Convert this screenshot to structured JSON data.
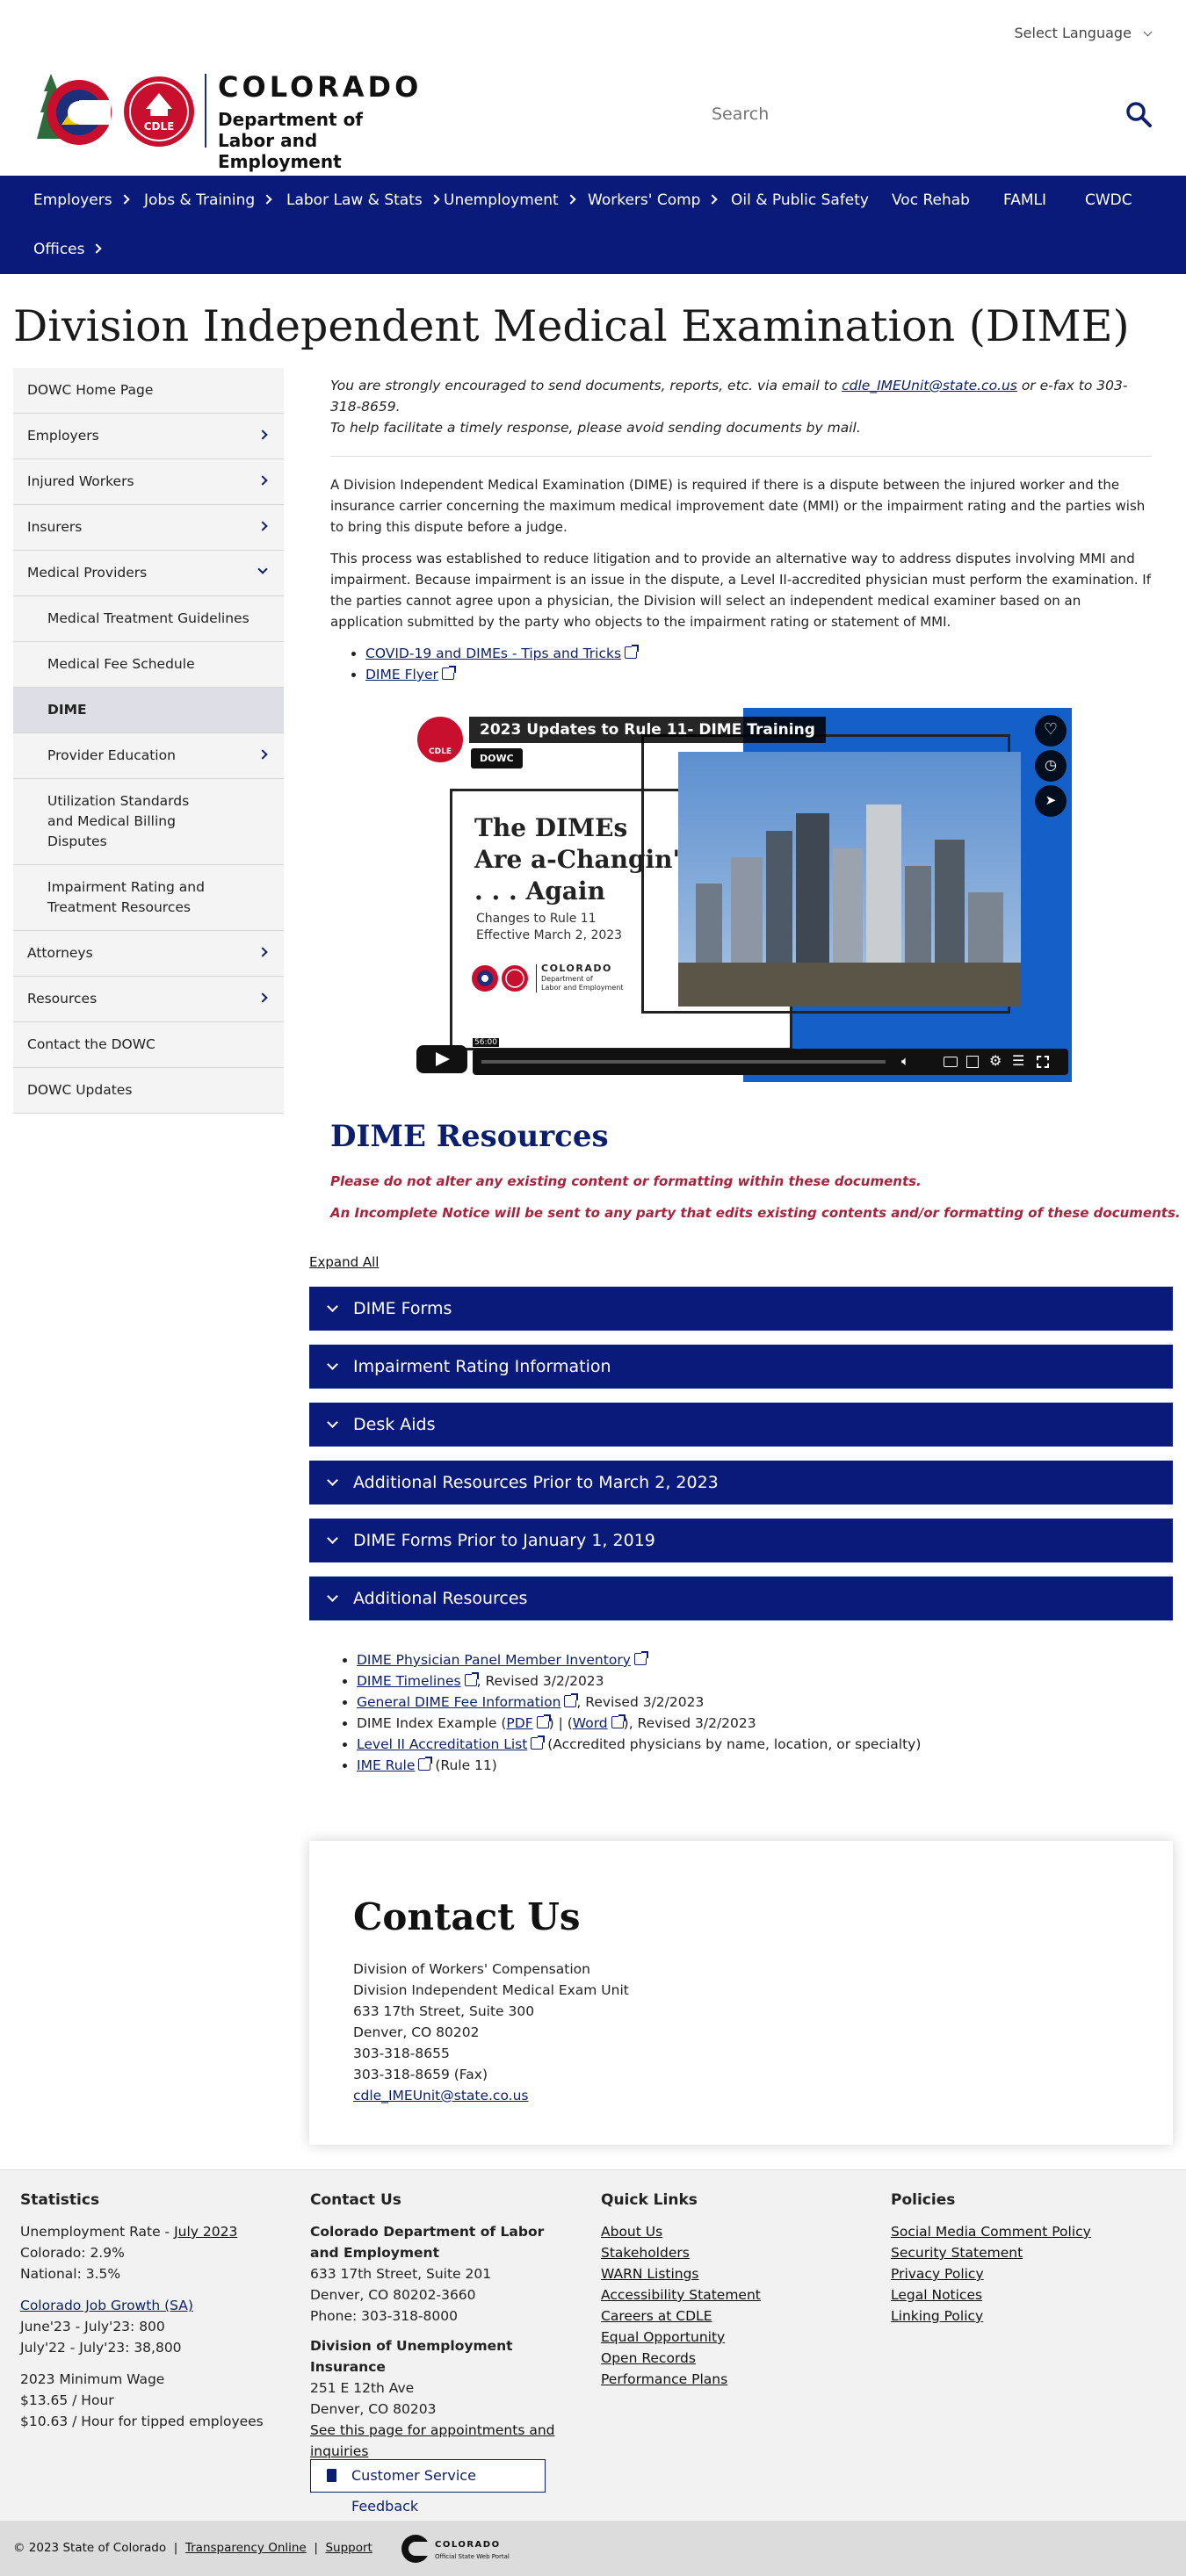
{
  "header": {
    "language_label": "Select Language",
    "logo_title": "COLORADO",
    "logo_sub1": "Department of",
    "logo_sub2": "Labor and Employment",
    "logo_badge": "CDLE",
    "search_placeholder": "Search"
  },
  "nav": {
    "items": [
      {
        "label": "Employers",
        "chev": true
      },
      {
        "label": "Jobs & Training",
        "chev": true
      },
      {
        "label": "Labor Law & Stats",
        "chev": true
      },
      {
        "label": "Unemployment",
        "chev": true
      },
      {
        "label": "Workers' Comp",
        "chev": true
      },
      {
        "label": "Oil & Public Safety",
        "chev": false
      },
      {
        "label": "Voc Rehab",
        "chev": false
      },
      {
        "label": "FAMLI",
        "chev": false
      },
      {
        "label": "CWDC",
        "chev": false
      },
      {
        "label": "Offices",
        "chev": true
      }
    ]
  },
  "page_title": "Division Independent Medical Examination (DIME)",
  "sidebar": {
    "items": [
      {
        "label": "DOWC Home Page"
      },
      {
        "label": "Employers"
      },
      {
        "label": "Injured Workers"
      },
      {
        "label": "Insurers"
      },
      {
        "label": "Medical Providers"
      },
      {
        "label": "Medical Treatment Guidelines"
      },
      {
        "label": "Medical Fee Schedule"
      },
      {
        "label": "DIME"
      },
      {
        "label": "Provider Education"
      },
      {
        "label": "Utilization Standards and Medical Billing Disputes"
      },
      {
        "label": "Impairment Rating and Treatment Resources"
      },
      {
        "label": "Attorneys"
      },
      {
        "label": "Resources"
      },
      {
        "label": "Contact the DOWC"
      },
      {
        "label": "DOWC Updates"
      }
    ]
  },
  "main": {
    "notice_pre": "You are strongly encouraged to send documents, reports, etc. via email to ",
    "notice_email": "cdle_IMEUnit@state.co.us",
    "notice_post": " or e-fax to 303-318-8659.",
    "notice_line2": "To help facilitate a timely response, please avoid sending documents by mail.",
    "para1": "A Division Independent Medical Examination (DIME) is required if there is a dispute between the injured worker and the insurance carrier concerning the maximum medical improvement date (MMI) or the impairment rating and the parties wish to bring this dispute before a judge.",
    "para2": "This process was established to reduce litigation and to provide an alternative way to address disputes involving MMI and impairment. Because impairment is an issue in the dispute, a Level II-accredited physician must perform the examination. If the parties cannot agree upon a physician, the Division will select an independent medical examiner based on an application submitted by the party who objects to the impairment rating or statement of MMI.",
    "link1": "COVID-19 and DIMEs - Tips and Tricks",
    "link2": "DIME Flyer"
  },
  "video": {
    "title": "2023 Updates to Rule 11- DIME Training",
    "channel": "DOWC",
    "badge": "CDLE",
    "slide_line1": "The DIMEs",
    "slide_line2": "Are a-Changin'",
    "slide_line3": ". . . Again",
    "slide_sub1": "Changes to Rule 11",
    "slide_sub2": "Effective March 2, 2023",
    "slide_logo_title": "COLORADO",
    "slide_logo_sub1": "Department of",
    "slide_logo_sub2": "Labor and Employment",
    "time": "56:00"
  },
  "resources": {
    "title": "DIME Resources",
    "warning1": "Please do not alter any existing content or formatting within these documents.",
    "warning2": "An Incomplete Notice will be sent to any party that edits existing contents and/or formatting of these documents.",
    "expand_all": "Expand All",
    "accordions": [
      "DIME Forms",
      "Impairment Rating Information",
      "Desk Aids",
      "Additional Resources Prior to March 2, 2023",
      "DIME Forms Prior to January 1, 2019",
      "Additional Resources"
    ],
    "list": {
      "item1": "DIME Physician Panel Member Inventory",
      "item2": "DIME Timelines",
      "item2_suffix": ", Revised 3/2/2023",
      "item3": "General DIME Fee Information",
      "item3_suffix": ", Revised 3/2/2023",
      "item4_prefix": "DIME Index Example (",
      "item4_pdf": "PDF",
      "item4_mid": ") | (",
      "item4_word": "Word",
      "item4_suffix": "), Revised 3/2/2023",
      "item5": "Level II Accreditation List",
      "item5_suffix": " (Accredited physicians by name, location, or specialty)",
      "item6": "IME Rule",
      "item6_suffix": " (Rule 11)"
    }
  },
  "contact": {
    "title": "Contact Us",
    "line1": "Division of Workers' Compensation",
    "line2": "Division Independent Medical Exam Unit",
    "line3": "633 17th Street, Suite 300",
    "line4": "Denver, CO 80202",
    "line5": "303-318-8655",
    "line6": "303-318-8659 (Fax)",
    "email": "cdle_IMEUnit@state.co.us"
  },
  "footer": {
    "stats": {
      "title": "Statistics",
      "ue_label": "Unemployment Rate - ",
      "ue_link": "July 2023",
      "colorado": "Colorado: 2.9%",
      "national": "National: 3.5%",
      "jobs_link": "Colorado Job Growth (SA)",
      "jobs1": "June'23 - July'23: 800",
      "jobs2": "July'22 - July'23: 38,800",
      "wage_title": "2023 Minimum Wage",
      "wage1": "$13.65 / Hour",
      "wage2": "$10.63 / Hour for tipped employees"
    },
    "contact": {
      "title": "Contact Us",
      "org": "Colorado Department of Labor and Employment",
      "addr1": "633 17th Street, Suite 201",
      "addr2": "Denver, CO  80202-3660",
      "phone": "Phone: 303-318-8000",
      "ui_title": "Division of Unemployment Insurance",
      "ui_addr1": "251 E 12th Ave",
      "ui_addr2": "Denver, CO  80203",
      "ui_link": "See this page for appointments and inquiries",
      "feedback": "Customer Service Feedback"
    },
    "quick_links": {
      "title": "Quick Links",
      "items": [
        "About Us",
        "Stakeholders",
        "WARN Listings",
        "Accessibility Statement",
        "Careers at CDLE",
        "Equal Opportunity",
        "Open Records",
        "Performance Plans"
      ]
    },
    "policies": {
      "title": "Policies",
      "items": [
        "Social Media Comment Policy",
        "Security Statement",
        "Privacy Policy",
        "Legal Notices",
        "Linking Policy"
      ]
    },
    "bottom": {
      "copyright": "© 2023 State of Colorado",
      "transparency": "Transparency Online",
      "support": "Support",
      "state_logo_title": "COLORADO",
      "state_logo_sub": "Official State Web Portal"
    }
  },
  "colors": {
    "navy": "#0a1a7a",
    "warning": "#a7243c",
    "link": "#0b1f6e"
  }
}
